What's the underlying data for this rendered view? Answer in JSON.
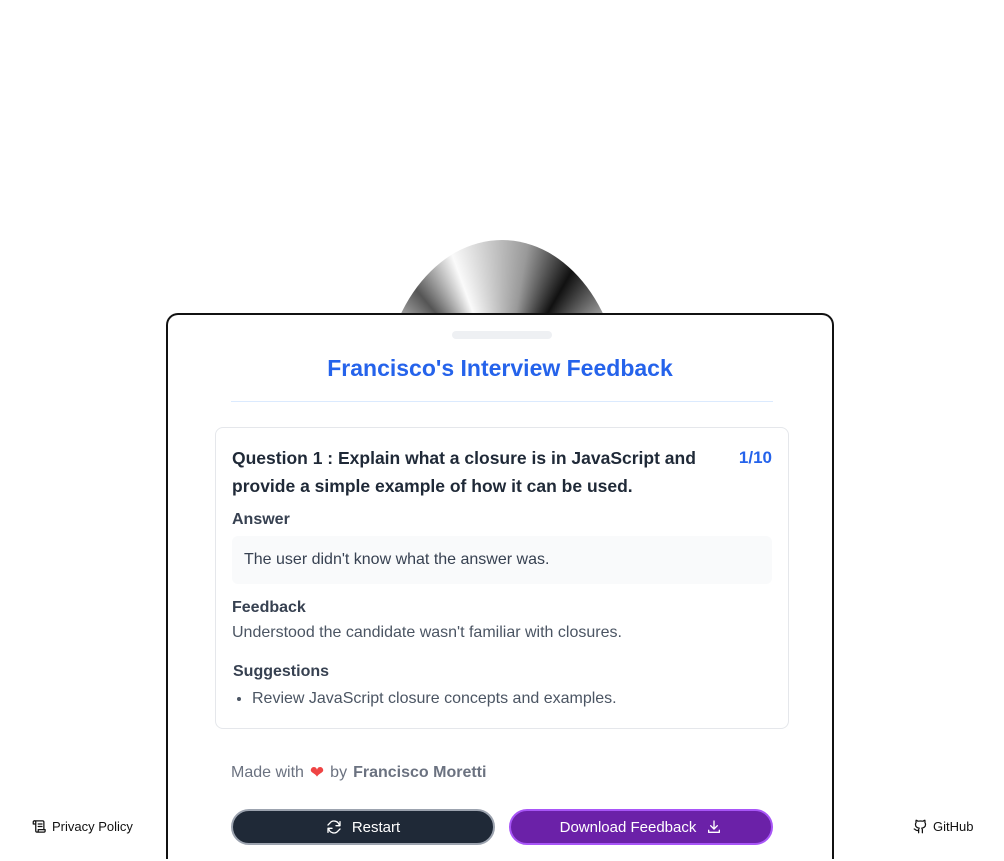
{
  "card": {
    "title": "Francisco's Interview Feedback"
  },
  "question": {
    "text": "Question 1 : Explain what a closure is in JavaScript and provide a simple example of how it can be used.",
    "counter": "1/10",
    "answer_label": "Answer",
    "answer_text": "The user didn't know what the answer was.",
    "feedback_label": "Feedback",
    "feedback_text": "Understood the candidate wasn't familiar with closures.",
    "suggestions_label": "Suggestions",
    "suggestions": [
      "Review JavaScript closure concepts and examples."
    ]
  },
  "credit": {
    "prefix": "Made with",
    "by": "by",
    "author": "Francisco Moretti"
  },
  "actions": {
    "restart_label": "Restart",
    "download_label": "Download Feedback"
  },
  "footer": {
    "privacy_label": "Privacy Policy",
    "github_label": "GitHub"
  },
  "icons": {
    "heart": "heart-icon",
    "restart": "refresh-icon",
    "download": "download-icon",
    "privacy": "scroll-icon",
    "github": "github-icon"
  },
  "colors": {
    "accent": "#2563eb",
    "restart_button": "#1f2937",
    "download_button": "#6b21a8",
    "heart": "#ef4444"
  }
}
